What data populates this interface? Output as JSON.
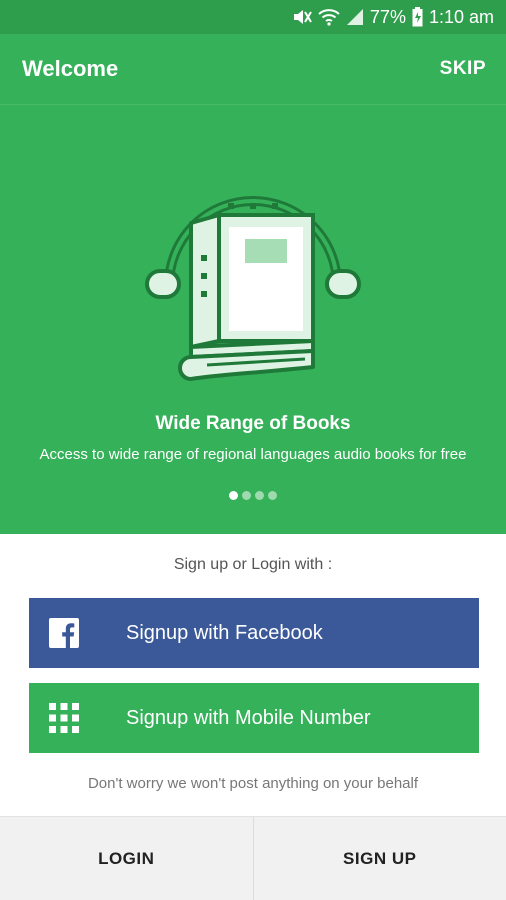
{
  "status_bar": {
    "battery": "77%",
    "time": "1:10 am"
  },
  "app_bar": {
    "title": "Welcome",
    "skip_label": "SKIP"
  },
  "onboarding": {
    "slide_title": "Wide Range of Books",
    "slide_description": "Access to wide range of regional languages audio books for free",
    "page_count": 4,
    "active_page": 1
  },
  "auth": {
    "prompt": "Sign up or Login with :",
    "facebook_label": "Signup with Facebook",
    "mobile_label": "Signup with Mobile Number",
    "disclaimer": "Don't worry we won't post anything on your behalf"
  },
  "bottom_bar": {
    "login_label": "LOGIN",
    "signup_label": "SIGN UP"
  },
  "colors": {
    "primary": "#35b15a",
    "status_bar": "#2f9e4c",
    "facebook": "#3b5998"
  },
  "icons": [
    "mute-icon",
    "wifi-icon",
    "signal-icon",
    "battery-icon",
    "headphone-book-icon",
    "facebook-icon",
    "dialpad-icon"
  ]
}
